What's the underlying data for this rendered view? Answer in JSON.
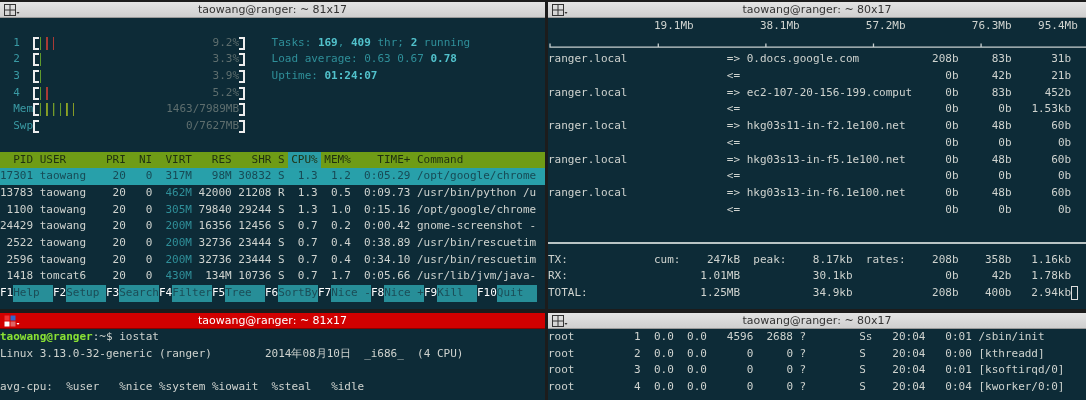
{
  "htop_window": {
    "title": "taowang@ranger: ~ 81x17",
    "active": false,
    "meters": [
      {
        "kind": "cpu",
        "label": "1",
        "level": 0.092,
        "reading": "9.2%"
      },
      {
        "kind": "cpu",
        "label": "2",
        "level": 0.033,
        "reading": "3.3%"
      },
      {
        "kind": "cpu",
        "label": "3",
        "level": 0.039,
        "reading": "3.9%"
      },
      {
        "kind": "cpu",
        "label": "4",
        "level": 0.052,
        "reading": "5.2%"
      },
      {
        "kind": "memory",
        "label": "Mem",
        "level": 0.183,
        "reading": "1463/7989MB"
      },
      {
        "kind": "swap",
        "label": "Swp",
        "level": 0,
        "reading": "0/7627MB"
      }
    ],
    "summary": [
      "Tasks: **169**, **409** thr; **2** running",
      "Load average: 0.63 0.67 **0.78**",
      "Uptime: **01:24:07**"
    ],
    "columns": [
      {
        "label": "PID",
        "selected": false
      },
      {
        "label": "USER",
        "selected": false
      },
      {
        "label": "PRI",
        "selected": false
      },
      {
        "label": "NI",
        "selected": false
      },
      {
        "label": "VIRT",
        "selected": false
      },
      {
        "label": "RES",
        "selected": false
      },
      {
        "label": "SHR",
        "selected": false
      },
      {
        "label": "S",
        "selected": false
      },
      {
        "label": "CPU%",
        "selected": true
      },
      {
        "label": "MEM%",
        "selected": false
      },
      {
        "label": "TIME+",
        "selected": false
      },
      {
        "label": "Command",
        "selected": false
      }
    ],
    "processes": [
      {
        "selected": true,
        "cells": [
          "17301",
          "taowang",
          "20",
          "0",
          "317M",
          "98M",
          "30832",
          "S",
          "1.3",
          "1.2",
          "0:05.29",
          "/opt/google/chrome"
        ]
      },
      {
        "selected": false,
        "cells": [
          "13783",
          "taowang",
          "20",
          "0",
          "462M",
          "42000",
          "21208",
          "R",
          "1.3",
          "0.5",
          "0:09.73",
          "/usr/bin/python /u"
        ]
      },
      {
        "selected": false,
        "cells": [
          "1100",
          "taowang",
          "20",
          "0",
          "305M",
          "79840",
          "29244",
          "S",
          "1.3",
          "1.0",
          "0:15.16",
          "/opt/google/chrome"
        ]
      },
      {
        "selected": false,
        "cells": [
          "24429",
          "taowang",
          "20",
          "0",
          "200M",
          "16356",
          "12456",
          "S",
          "0.7",
          "0.2",
          "0:00.42",
          "gnome-screenshot -"
        ]
      },
      {
        "selected": false,
        "cells": [
          "2522",
          "taowang",
          "20",
          "0",
          "200M",
          "32736",
          "23444",
          "S",
          "0.7",
          "0.4",
          "0:38.89",
          "/usr/bin/rescuetim"
        ]
      },
      {
        "selected": false,
        "cells": [
          "2596",
          "taowang",
          "20",
          "0",
          "200M",
          "32736",
          "23444",
          "S",
          "0.7",
          "0.4",
          "0:34.10",
          "/usr/bin/rescuetim"
        ]
      },
      {
        "selected": false,
        "cells": [
          "1418",
          "tomcat6",
          "20",
          "0",
          "430M",
          "134M",
          "10736",
          "S",
          "0.7",
          "1.7",
          "0:05.66",
          "/usr/lib/jvm/java-"
        ]
      }
    ],
    "function_keys": [
      {
        "key": "F1",
        "label": "Help"
      },
      {
        "key": "F2",
        "label": "Setup"
      },
      {
        "key": "F3",
        "label": "Search"
      },
      {
        "key": "F4",
        "label": "Filter"
      },
      {
        "key": "F5",
        "label": "Tree"
      },
      {
        "key": "F6",
        "label": "SortBy"
      },
      {
        "key": "F7",
        "label": "Nice -"
      },
      {
        "key": "F8",
        "label": "Nice +"
      },
      {
        "key": "F9",
        "label": "Kill"
      },
      {
        "key": "F10",
        "label": "Quit"
      }
    ]
  },
  "iftop_window": {
    "title": "taowang@ranger: ~ 80x17",
    "active": false,
    "scale": [
      "19.1Mb",
      "38.1Mb",
      "57.2Mb",
      "76.3Mb",
      "95.4Mb"
    ],
    "flows": [
      {
        "host": "ranger.local",
        "send_arrow": "=>",
        "remote": "0.docs.google.com",
        "sent": [
          "208b",
          "83b",
          "31b"
        ],
        "receive_arrow": "<=",
        "received": [
          "0b",
          "42b",
          "21b"
        ]
      },
      {
        "host": "ranger.local",
        "send_arrow": "=>",
        "remote": "ec2-107-20-156-199.comput",
        "sent": [
          "0b",
          "83b",
          "452b"
        ],
        "receive_arrow": "<=",
        "received": [
          "0b",
          "0b",
          "1.53kb"
        ]
      },
      {
        "host": "ranger.local",
        "send_arrow": "=>",
        "remote": "hkg03s11-in-f2.1e100.net",
        "sent": [
          "0b",
          "48b",
          "60b"
        ],
        "receive_arrow": "<=",
        "received": [
          "0b",
          "0b",
          "0b"
        ]
      },
      {
        "host": "ranger.local",
        "send_arrow": "=>",
        "remote": "hkg03s13-in-f5.1e100.net",
        "sent": [
          "0b",
          "48b",
          "60b"
        ],
        "receive_arrow": "<=",
        "received": [
          "0b",
          "0b",
          "0b"
        ]
      },
      {
        "host": "ranger.local",
        "send_arrow": "=>",
        "remote": "hkg03s13-in-f6.1e100.net",
        "sent": [
          "0b",
          "48b",
          "60b"
        ],
        "receive_arrow": "<=",
        "received": [
          "0b",
          "0b",
          "0b"
        ]
      }
    ],
    "totals": [
      {
        "label": "TX:",
        "cum_label": "cum:",
        "cum": "247kB",
        "peak_label": "peak:",
        "peak": "8.17kb",
        "rates_label": "rates:",
        "rates": [
          "208b",
          "358b",
          "1.16kb"
        ]
      },
      {
        "label": "RX:",
        "cum": "1.01MB",
        "peak": "30.1kb",
        "rates": [
          "0b",
          "42b",
          "1.78kb"
        ]
      },
      {
        "label": "TOTAL:",
        "cum": "1.25MB",
        "peak": "34.9kb",
        "rates": [
          "208b",
          "400b",
          "2.94kb"
        ]
      }
    ]
  },
  "shell_window": {
    "title": "taowang@ranger: ~ 81x17",
    "active": true,
    "prompt_host": "taowang@ranger",
    "prompt_path": ":~$",
    "command": "iostat",
    "output_blocks": [
      [
        "Linux 3.13.0-32-generic (ranger)        2014年08月10日  _i686_  (4 CPU)"
      ],
      [
        "avg-cpu:  %user   %nice %system %iowait  %steal   %idle"
      ]
    ]
  },
  "ps_window": {
    "title": "taowang@ranger: ~ 80x17",
    "active": false,
    "rows": [
      [
        "root",
        "1",
        "0.0",
        "0.0",
        "4596",
        "2688",
        "?",
        "Ss",
        "20:04",
        "0:01",
        "/sbin/init"
      ],
      [
        "root",
        "2",
        "0.0",
        "0.0",
        "0",
        "0",
        "?",
        "S",
        "20:04",
        "0:00",
        "[kthreadd]"
      ],
      [
        "root",
        "3",
        "0.0",
        "0.0",
        "0",
        "0",
        "?",
        "S",
        "20:04",
        "0:01",
        "[ksoftirqd/0]"
      ],
      [
        "root",
        "4",
        "0.0",
        "0.0",
        "0",
        "0",
        "?",
        "S",
        "20:04",
        "0:04",
        "[kworker/0:0]"
      ]
    ]
  }
}
